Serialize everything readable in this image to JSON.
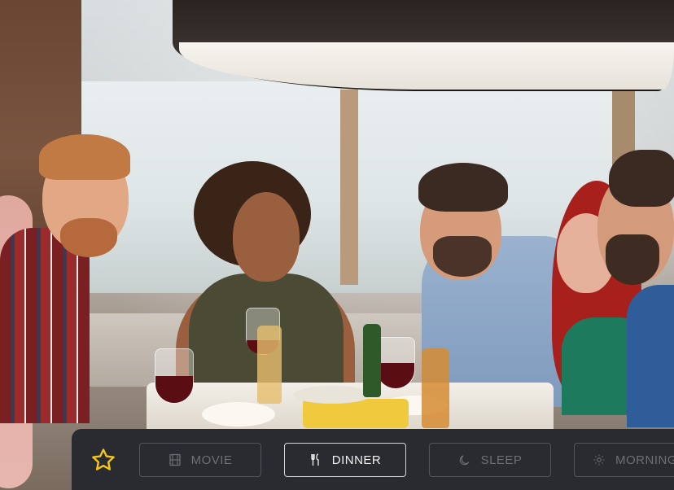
{
  "scene_bar": {
    "favorite_icon": "star-icon",
    "accent_color": "#f5c518",
    "buttons": [
      {
        "label": "MOVIE",
        "icon": "film-icon",
        "active": false
      },
      {
        "label": "DINNER",
        "icon": "cutlery-icon",
        "active": true
      },
      {
        "label": "SLEEP",
        "icon": "moon-icon",
        "active": false
      },
      {
        "label": "MORNING",
        "icon": "sun-icon",
        "active": false
      }
    ]
  }
}
